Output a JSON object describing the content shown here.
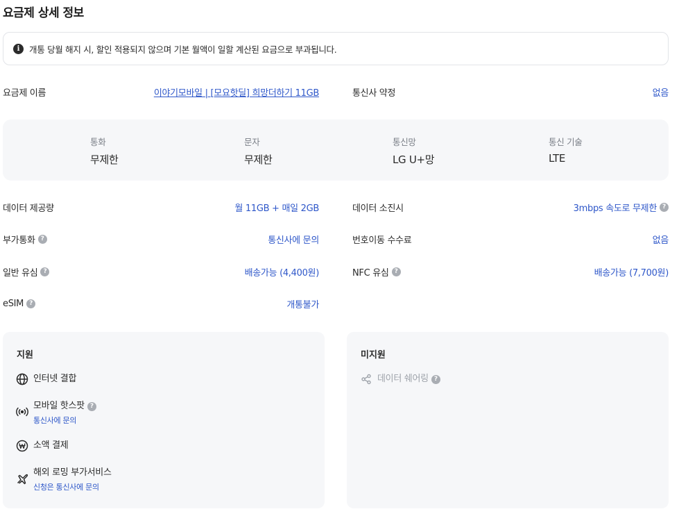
{
  "title": "요금제 상세 정보",
  "notice": {
    "text": "개통 당월 해지 시, 할인 적용되지 않으며 기본 월액이 일할 계산된 요금으로 부과됩니다."
  },
  "info_left": [
    {
      "label": "요금제 이름",
      "value": "이야기모바일 | [모요핫딜] 희망더하기 11GB"
    },
    {
      "label": "데이터 제공량",
      "value": "월 11GB + 매일 2GB"
    },
    {
      "label": "부가통화",
      "value": "통신사에 문의"
    },
    {
      "label": "일반 유심",
      "value": "배송가능 (4,400원)"
    },
    {
      "label": "eSIM",
      "value": "개통불가"
    }
  ],
  "info_right": [
    {
      "label": "통신사 약정",
      "value": "없음"
    },
    {
      "label": "데이터 소진시",
      "value": "3mbps 속도로 무제한"
    },
    {
      "label": "번호이동 수수료",
      "value": "없음"
    },
    {
      "label": "NFC 유심",
      "value": "배송가능 (7,700원)"
    }
  ],
  "specs": [
    {
      "label": "통화",
      "value": "무제한"
    },
    {
      "label": "문자",
      "value": "무제한"
    },
    {
      "label": "통신망",
      "value": "LG U+망"
    },
    {
      "label": "통신 기술",
      "value": "LTE"
    }
  ],
  "supported": {
    "title": "지원",
    "items": [
      {
        "name": "인터넷 결합",
        "icon": "globe-icon"
      },
      {
        "name": "모바일 핫스팟",
        "sub": "통신사에 문의",
        "icon": "hotspot-icon"
      },
      {
        "name": "소액 결제",
        "icon": "won-icon"
      },
      {
        "name": "해외 로밍 부가서비스",
        "sub": "신청은 통신사에 문의",
        "icon": "airplane-icon"
      }
    ]
  },
  "unsupported": {
    "title": "미지원",
    "items": [
      {
        "name": "데이터 쉐어링",
        "icon": "share-icon"
      }
    ]
  },
  "help_glyph": "?",
  "info_glyph": "i",
  "colors": {
    "accent": "#2e57c9",
    "panel_bg": "#f6f7f9",
    "muted": "#9ea3aa"
  }
}
